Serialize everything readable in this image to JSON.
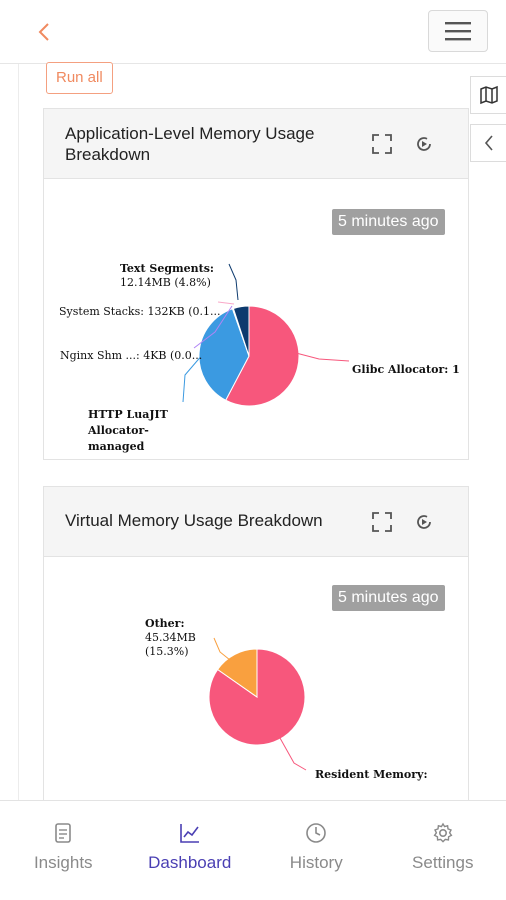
{
  "header": {
    "back_icon": "chevron-left-icon",
    "menu_icon": "hamburger-menu-icon"
  },
  "toolbar": {
    "run_all_label": "Run all"
  },
  "side_buttons": {
    "map_icon": "map-icon",
    "collapse_icon": "chevron-left-icon"
  },
  "cards": [
    {
      "title": "Application-Level Memory Usage Breakdown",
      "badge": "5 minutes ago",
      "fullscreen_icon": "fullscreen-icon",
      "refresh_icon": "refresh-icon",
      "chart_data": {
        "type": "pie",
        "title": "",
        "slices": [
          {
            "label": "Glibc Allocator: 1",
            "value": 55,
            "color": "#f7577c"
          },
          {
            "label": "HTTP LuaJIT Allocator-managed",
            "value": 35.2,
            "color": "#3b9ae1"
          },
          {
            "label": "Nginx Shm ...: 4KB (0.0...",
            "value": 0.1,
            "color": "#b085f5"
          },
          {
            "label": "System Stacks: 132KB (0.1...",
            "value": 0.2,
            "color": "#f9a8c8"
          },
          {
            "label": "Text Segments:",
            "sublabel": "12.14MB (4.8%)",
            "value": 4.8,
            "color": "#0d3a6e"
          }
        ]
      }
    },
    {
      "title": "Virtual Memory Usage Breakdown",
      "badge": "5 minutes ago",
      "fullscreen_icon": "fullscreen-icon",
      "refresh_icon": "refresh-icon",
      "chart_data": {
        "type": "pie",
        "title": "",
        "slices": [
          {
            "label": "Resident Memory:",
            "value": 84.7,
            "color": "#f7577c"
          },
          {
            "label": "Other:",
            "sublabel_1": "45.34MB",
            "sublabel_2": "(15.3%)",
            "value": 15.3,
            "color": "#f9a03f"
          }
        ]
      }
    }
  ],
  "nav": {
    "items": [
      {
        "label": "Insights",
        "icon": "document-icon",
        "active": false
      },
      {
        "label": "Dashboard",
        "icon": "line-chart-icon",
        "active": true
      },
      {
        "label": "History",
        "icon": "clock-icon",
        "active": false
      },
      {
        "label": "Settings",
        "icon": "gear-icon",
        "active": false
      }
    ]
  },
  "colors": {
    "accent": "#4a3fb3",
    "run_all": "#f08a60",
    "badge_bg": "#a0a0a0"
  }
}
